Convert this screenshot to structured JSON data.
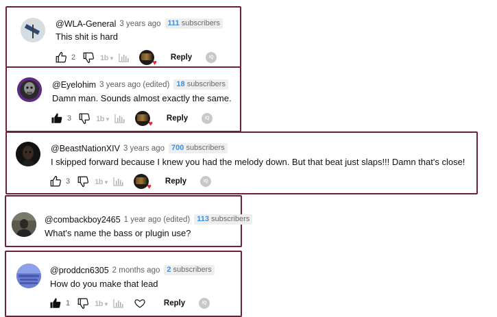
{
  "colors": {
    "card_border": "#6d1f36",
    "subscriber_count": "#3a8ee6",
    "heart": "#e0262f"
  },
  "comments": [
    {
      "author": "@WLA-General",
      "time": "3 years ago",
      "subs_count": "111",
      "subs_label": "subscribers",
      "text": "This shit is hard",
      "likes": "2",
      "liked": false,
      "creator_hearted": true,
      "reply_label": "Reply",
      "iq_label": "IQ"
    },
    {
      "author": "@Eyelohim",
      "time": "3 years ago (edited)",
      "subs_count": "18",
      "subs_label": "subscribers",
      "text": "Damn man. Sounds almost exactly the same.",
      "likes": "3",
      "liked": true,
      "creator_hearted": true,
      "reply_label": "Reply",
      "iq_label": "IQ"
    },
    {
      "author": "@BeastNationXIV",
      "time": "3 years ago",
      "subs_count": "700",
      "subs_label": "subscribers",
      "text": "I skipped forward because I knew you had the melody down. But that beat just slaps!!! Damn that's close!",
      "likes": "3",
      "liked": false,
      "creator_hearted": true,
      "reply_label": "Reply",
      "iq_label": "IQ"
    },
    {
      "author": "@combackboy2465",
      "time": "1 year ago (edited)",
      "subs_count": "113",
      "subs_label": "subscribers",
      "text": "What's name the bass or plugin use?"
    },
    {
      "author": "@proddcn6305",
      "time": "2 months ago",
      "subs_count": "2",
      "subs_label": "subscribers",
      "text": "How do you make that lead",
      "likes": "1",
      "liked": true,
      "creator_hearted": false,
      "reply_label": "Reply",
      "iq_label": "IQ"
    }
  ],
  "icons": {
    "like": "thumbs-up-icon",
    "dislike": "thumbs-down-icon",
    "sort_number": "1b",
    "stats": "bar-chart-icon",
    "heart": "heart-outline-icon"
  }
}
